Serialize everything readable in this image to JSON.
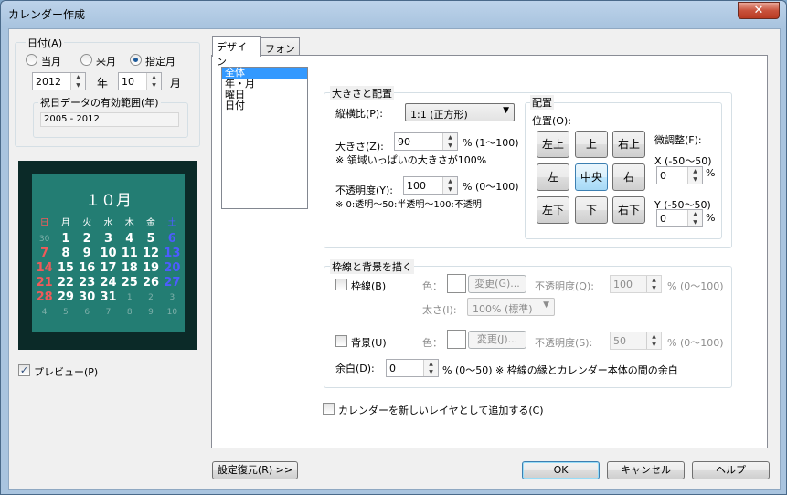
{
  "window": {
    "title": "カレンダー作成",
    "close_label": "✕"
  },
  "date_group": {
    "label": "日付(A)",
    "radio_this_month": "当月",
    "radio_next_month": "来月",
    "radio_specified": "指定月",
    "year_value": "2012",
    "year_unit": "年",
    "month_value": "10",
    "month_unit": "月",
    "holiday_label": "祝日データの有効範囲(年)",
    "holiday_range": "2005 - 2012"
  },
  "preview": {
    "label": "プレビュー(P)",
    "checked": true,
    "month_title": "１０月",
    "weekdays": [
      "日",
      "月",
      "火",
      "水",
      "木",
      "金",
      "土"
    ],
    "weeks": [
      [
        "30",
        "1",
        "2",
        "3",
        "4",
        "5",
        "6"
      ],
      [
        "7",
        "8",
        "9",
        "10",
        "11",
        "12",
        "13"
      ],
      [
        "14",
        "15",
        "16",
        "17",
        "18",
        "19",
        "20"
      ],
      [
        "21",
        "22",
        "23",
        "24",
        "25",
        "26",
        "27"
      ],
      [
        "28",
        "29",
        "30",
        "31",
        "1",
        "2",
        "3"
      ],
      [
        "4",
        "5",
        "6",
        "7",
        "8",
        "9",
        "10"
      ]
    ]
  },
  "tabs": [
    "デザイン",
    "フォント"
  ],
  "list": {
    "items": [
      "全体",
      "年・月",
      "曜日",
      "日付"
    ],
    "selected": 0
  },
  "size_group": {
    "label": "大きさと配置",
    "aspect_label": "縦横比(P):",
    "aspect_value": "1:1 (正方形)",
    "size_label": "大きさ(Z):",
    "size_value": "90",
    "size_range": "% (1～100)",
    "size_note": "※ 領域いっぱいの大きさが100%",
    "opacity_label": "不透明度(Y):",
    "opacity_value": "100",
    "opacity_range": "% (0～100)",
    "opacity_note": "※ 0:透明～50:半透明～100:不透明"
  },
  "placement": {
    "label": "配置",
    "pos_label": "位置(O):",
    "buttons": [
      "左上",
      "上",
      "右上",
      "左",
      "中央",
      "右",
      "左下",
      "下",
      "右下"
    ],
    "selected": "中央",
    "fine_label": "微調整(F):",
    "x_label": "X (-50～50)",
    "x_value": "0",
    "y_label": "Y (-50～50)",
    "y_value": "0",
    "unit": "%"
  },
  "border_group": {
    "label": "枠線と背景を描く",
    "border_check": "枠線(B)",
    "color_label": "色：",
    "change_label": "変更(G)...",
    "opacity_label": "不透明度(Q):",
    "opacity_value": "100",
    "range": "% (0～100)",
    "thickness_label": "太さ(I):",
    "thickness_value": "100% (標準)",
    "bg_check": "背景(U)",
    "bg_change_label": "変更(J)...",
    "bg_opacity_label": "不透明度(S):",
    "bg_opacity_value": "50",
    "margin_label": "余白(D):",
    "margin_value": "0",
    "margin_note": "% (0～50) ※ 枠線の縁とカレンダー本体の間の余白"
  },
  "add_layer": "カレンダーを新しいレイヤとして追加する(C)",
  "buttons": {
    "restore": "設定復元(R) >>",
    "ok": "OK",
    "cancel": "キャンセル",
    "help": "ヘルプ"
  }
}
